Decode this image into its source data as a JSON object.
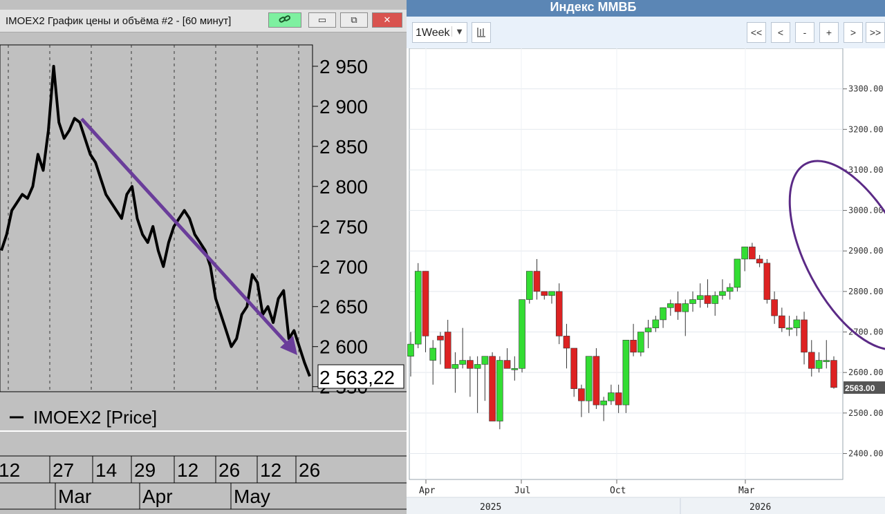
{
  "left_panel": {
    "window_title": "IMOEX2 График цены и объёма #2 - [60 минут]",
    "buttons": {
      "link_icon": "link-icon",
      "minimize": "▭",
      "restore": "⧉",
      "close": "✕"
    },
    "colors": {
      "background": "#c0c0c0",
      "price_line": "#000000",
      "trend_arrow": "#6a3d9a",
      "link_button": "#7ef0a0",
      "close_button": "#d9534f"
    }
  },
  "right_panel": {
    "title": "Индекс ММВБ",
    "period_label": "1Week",
    "period_arrow": "▼",
    "nav_buttons": [
      "<<",
      "<",
      "-",
      "+",
      ">",
      ">>"
    ],
    "colors": {
      "header": "#5b86b5",
      "toolbar": "#e9f1fa",
      "up_candle": "#33dd33",
      "down_candle": "#dd2222",
      "annotation": "#5b2a86"
    }
  },
  "chart_data": [
    {
      "type": "line",
      "series": [
        {
          "name": "IMOEX2 [Price]",
          "values": [
            2720,
            2740,
            2770,
            2780,
            2790,
            2785,
            2800,
            2840,
            2820,
            2870,
            2950,
            2880,
            2860,
            2870,
            2885,
            2880,
            2860,
            2840,
            2830,
            2810,
            2790,
            2780,
            2770,
            2760,
            2790,
            2800,
            2760,
            2740,
            2730,
            2750,
            2720,
            2700,
            2730,
            2750,
            2760,
            2770,
            2760,
            2740,
            2730,
            2720,
            2700,
            2660,
            2640,
            2620,
            2600,
            2610,
            2640,
            2650,
            2690,
            2680,
            2640,
            2650,
            2630,
            2660,
            2670,
            2610,
            2620,
            2600,
            2580,
            2563
          ]
        }
      ],
      "yticks": [
        "2 950",
        "2 900",
        "2 850",
        "2 800",
        "2 750",
        "2 700",
        "2 650",
        "2 600",
        "2 550"
      ],
      "ylim": [
        2548,
        2962
      ],
      "last_price_label": "2 563,22",
      "legend": "IMOEX2 [Price]",
      "x_day_labels": [
        "12",
        "27",
        "14",
        "29",
        "12",
        "26",
        "12",
        "26"
      ],
      "x_month_labels": [
        "Mar",
        "Apr",
        "May"
      ],
      "grid": true,
      "annotation": "downtrend arrow"
    },
    {
      "type": "candlestick",
      "candles": [
        {
          "o": 2640,
          "h": 2700,
          "l": 2590,
          "c": 2670
        },
        {
          "o": 2670,
          "h": 2870,
          "l": 2660,
          "c": 2850
        },
        {
          "o": 2850,
          "h": 2850,
          "l": 2650,
          "c": 2690
        },
        {
          "o": 2630,
          "h": 2680,
          "l": 2570,
          "c": 2660
        },
        {
          "o": 2690,
          "h": 2700,
          "l": 2620,
          "c": 2680
        },
        {
          "o": 2700,
          "h": 2730,
          "l": 2620,
          "c": 2610
        },
        {
          "o": 2610,
          "h": 2650,
          "l": 2550,
          "c": 2620
        },
        {
          "o": 2620,
          "h": 2710,
          "l": 2610,
          "c": 2630
        },
        {
          "o": 2630,
          "h": 2640,
          "l": 2540,
          "c": 2610
        },
        {
          "o": 2610,
          "h": 2640,
          "l": 2500,
          "c": 2620
        },
        {
          "o": 2620,
          "h": 2640,
          "l": 2530,
          "c": 2640
        },
        {
          "o": 2640,
          "h": 2650,
          "l": 2490,
          "c": 2480
        },
        {
          "o": 2480,
          "h": 2640,
          "l": 2460,
          "c": 2630
        },
        {
          "o": 2630,
          "h": 2660,
          "l": 2610,
          "c": 2610
        },
        {
          "o": 2610,
          "h": 2640,
          "l": 2580,
          "c": 2610
        },
        {
          "o": 2610,
          "h": 2780,
          "l": 2600,
          "c": 2780
        },
        {
          "o": 2780,
          "h": 2850,
          "l": 2770,
          "c": 2850
        },
        {
          "o": 2850,
          "h": 2880,
          "l": 2780,
          "c": 2800
        },
        {
          "o": 2800,
          "h": 2800,
          "l": 2780,
          "c": 2790
        },
        {
          "o": 2790,
          "h": 2800,
          "l": 2770,
          "c": 2800
        },
        {
          "o": 2800,
          "h": 2820,
          "l": 2670,
          "c": 2690
        },
        {
          "o": 2690,
          "h": 2720,
          "l": 2610,
          "c": 2660
        },
        {
          "o": 2660,
          "h": 2660,
          "l": 2540,
          "c": 2560
        },
        {
          "o": 2560,
          "h": 2570,
          "l": 2490,
          "c": 2530
        },
        {
          "o": 2530,
          "h": 2640,
          "l": 2500,
          "c": 2640
        },
        {
          "o": 2640,
          "h": 2660,
          "l": 2510,
          "c": 2520
        },
        {
          "o": 2520,
          "h": 2540,
          "l": 2480,
          "c": 2530
        },
        {
          "o": 2530,
          "h": 2570,
          "l": 2520,
          "c": 2550
        },
        {
          "o": 2550,
          "h": 2570,
          "l": 2500,
          "c": 2520
        },
        {
          "o": 2520,
          "h": 2680,
          "l": 2500,
          "c": 2680
        },
        {
          "o": 2680,
          "h": 2720,
          "l": 2640,
          "c": 2650
        },
        {
          "o": 2650,
          "h": 2700,
          "l": 2640,
          "c": 2700
        },
        {
          "o": 2700,
          "h": 2730,
          "l": 2660,
          "c": 2710
        },
        {
          "o": 2710,
          "h": 2740,
          "l": 2700,
          "c": 2730
        },
        {
          "o": 2730,
          "h": 2760,
          "l": 2710,
          "c": 2760
        },
        {
          "o": 2760,
          "h": 2780,
          "l": 2740,
          "c": 2770
        },
        {
          "o": 2770,
          "h": 2800,
          "l": 2730,
          "c": 2750
        },
        {
          "o": 2750,
          "h": 2780,
          "l": 2690,
          "c": 2770
        },
        {
          "o": 2770,
          "h": 2800,
          "l": 2750,
          "c": 2780
        },
        {
          "o": 2780,
          "h": 2820,
          "l": 2760,
          "c": 2790
        },
        {
          "o": 2790,
          "h": 2830,
          "l": 2760,
          "c": 2770
        },
        {
          "o": 2770,
          "h": 2800,
          "l": 2740,
          "c": 2790
        },
        {
          "o": 2790,
          "h": 2830,
          "l": 2780,
          "c": 2800
        },
        {
          "o": 2800,
          "h": 2820,
          "l": 2780,
          "c": 2810
        },
        {
          "o": 2810,
          "h": 2880,
          "l": 2800,
          "c": 2880
        },
        {
          "o": 2880,
          "h": 2900,
          "l": 2850,
          "c": 2910
        },
        {
          "o": 2910,
          "h": 2920,
          "l": 2880,
          "c": 2880
        },
        {
          "o": 2880,
          "h": 2890,
          "l": 2860,
          "c": 2870
        },
        {
          "o": 2870,
          "h": 2880,
          "l": 2770,
          "c": 2780
        },
        {
          "o": 2780,
          "h": 2800,
          "l": 2720,
          "c": 2740
        },
        {
          "o": 2740,
          "h": 2760,
          "l": 2700,
          "c": 2710
        },
        {
          "o": 2710,
          "h": 2740,
          "l": 2690,
          "c": 2710
        },
        {
          "o": 2710,
          "h": 2740,
          "l": 2690,
          "c": 2730
        },
        {
          "o": 2730,
          "h": 2750,
          "l": 2620,
          "c": 2650
        },
        {
          "o": 2650,
          "h": 2680,
          "l": 2590,
          "c": 2610
        },
        {
          "o": 2610,
          "h": 2650,
          "l": 2600,
          "c": 2630
        },
        {
          "o": 2630,
          "h": 2680,
          "l": 2610,
          "c": 2630
        },
        {
          "o": 2630,
          "h": 2640,
          "l": 2560,
          "c": 2563
        }
      ],
      "yticks": [
        "3300.00",
        "3200.00",
        "3100.00",
        "3000.00",
        "2900.00",
        "2800.00",
        "2700.00",
        "2600.00",
        "2500.00",
        "2400.00"
      ],
      "ylim": [
        2336,
        3400
      ],
      "last_price_label": "2563.00",
      "x_month_labels": [
        "Apr",
        "Jul",
        "Oct",
        "Mar"
      ],
      "x_year_labels": [
        "2025",
        "2026"
      ],
      "grid": true,
      "annotation": "ellipse around recent decline"
    }
  ]
}
